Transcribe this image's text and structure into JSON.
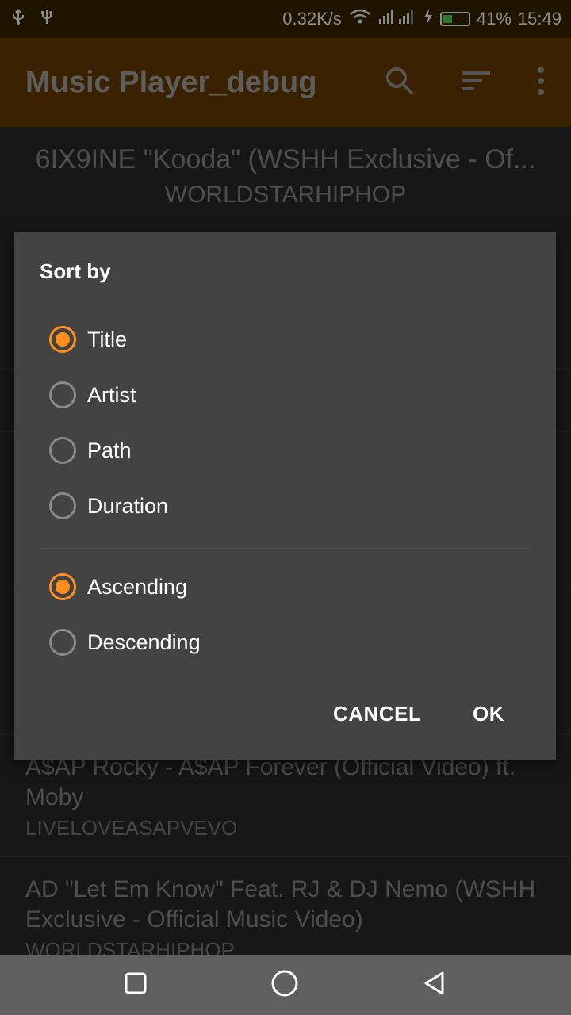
{
  "status_bar": {
    "left_icons": [
      "usb-icon",
      "usb-debug-icon"
    ],
    "speed": "0.32K/s",
    "battery_percent": "41%",
    "time": "15:49"
  },
  "toolbar": {
    "title": "Music Player_debug",
    "icons": [
      "search-icon",
      "sort-icon",
      "more-vert-icon"
    ]
  },
  "now_playing": {
    "title": "6IX9INE \"Kooda\" (WSHH Exclusive - Of...",
    "artist": "WORLDSTARHIPHOP"
  },
  "list": [
    {
      "title": "A$AP Rocky - A$AP Forever (Official Video) ft. Moby",
      "artist": "LIVELOVEASAPVEVO"
    },
    {
      "title": "AD \"Let Em Know\" Feat. RJ & DJ Nemo (WSHH Exclusive - Official Music Video)",
      "artist": "WORLDSTARHIPHOP"
    }
  ],
  "dialog": {
    "title": "Sort by",
    "sort_field": {
      "options": [
        "Title",
        "Artist",
        "Path",
        "Duration"
      ],
      "selected": "Title"
    },
    "order": {
      "options": [
        "Ascending",
        "Descending"
      ],
      "selected": "Ascending"
    },
    "cancel_label": "CANCEL",
    "ok_label": "OK",
    "accent_color": "#ff8f1c"
  },
  "nav_bar": {
    "icons": [
      "recents-square-icon",
      "home-circle-icon",
      "back-triangle-icon"
    ]
  }
}
